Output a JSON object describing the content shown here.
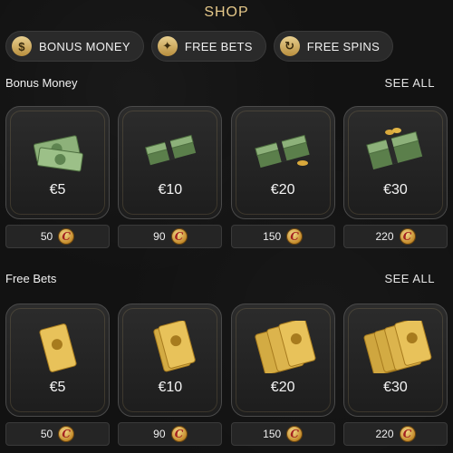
{
  "header": {
    "title": "SHOP"
  },
  "tabs": [
    {
      "label": "BONUS MONEY",
      "icon": "dollar-coin-icon",
      "glyph": "$"
    },
    {
      "label": "FREE BETS",
      "icon": "ticket-icon",
      "glyph": "✦"
    },
    {
      "label": "FREE SPINS",
      "icon": "spin-arrows-icon",
      "glyph": "↻"
    }
  ],
  "sections": [
    {
      "title": "Bonus Money",
      "see_all": "SEE ALL",
      "items": [
        {
          "price": "€5",
          "cost": "50"
        },
        {
          "price": "€10",
          "cost": "90"
        },
        {
          "price": "€20",
          "cost": "150"
        },
        {
          "price": "€30",
          "cost": "220"
        }
      ]
    },
    {
      "title": "Free Bets",
      "see_all": "SEE ALL",
      "items": [
        {
          "price": "€5",
          "cost": "50"
        },
        {
          "price": "€10",
          "cost": "90"
        },
        {
          "price": "€20",
          "cost": "150"
        },
        {
          "price": "€30",
          "cost": "220"
        }
      ]
    }
  ],
  "coin_glyph": "C",
  "colors": {
    "accent": "#e6c98a",
    "background": "#121212",
    "card": "#2c2c2c",
    "cash": "#7fa06b",
    "ticket": "#e2b545"
  }
}
